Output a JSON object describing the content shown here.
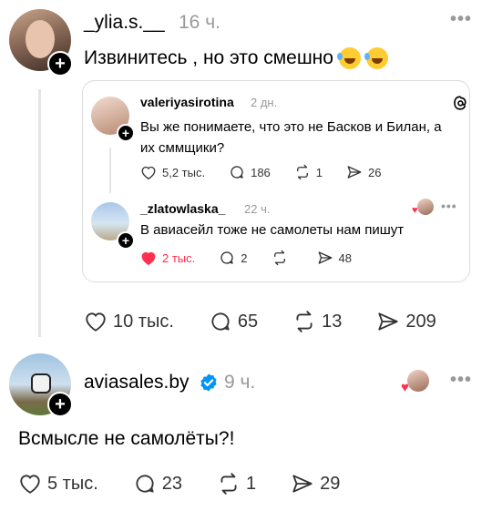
{
  "post": {
    "username": "_ylia.s.__",
    "time": "16 ч.",
    "text": "Извинитесь , но это смешно",
    "emojis": [
      "sweat-smile-emoji",
      "joy-emoji"
    ],
    "likes": "10 тыс.",
    "comments": "65",
    "reposts": "13",
    "shares": "209"
  },
  "quote": {
    "threads_icon": "threads-logo-icon",
    "first": {
      "username": "valeriyasirotina",
      "time": "2 дн.",
      "text": "Вы же понимаете, что это не Басков и Билан, а их сммщики?",
      "likes": "5,2 тыс.",
      "comments": "186",
      "reposts": "1",
      "shares": "26"
    },
    "second": {
      "username": "_zlatowlaska_",
      "time": "22 ч.",
      "text": "В авиасейл тоже не самолеты нам пишут",
      "likes": "2 тыс.",
      "comments": "2",
      "reposts": "",
      "shares": "48",
      "liked": true
    }
  },
  "reply": {
    "username": "aviasales.by",
    "verified": true,
    "time": "9 ч.",
    "text": "Всмысле не самолёты?!",
    "likes": "5 тыс.",
    "comments": "23",
    "reposts": "1",
    "shares": "29"
  },
  "colors": {
    "like_red": "#ff304f",
    "verified_blue": "#0095f6",
    "muted": "#999999"
  },
  "icons": {
    "like": "heart-icon",
    "comment": "comment-bubble-icon",
    "repost": "repost-icon",
    "share": "share-paper-plane-icon",
    "more": "more-dots-icon",
    "follow": "plus-icon"
  }
}
